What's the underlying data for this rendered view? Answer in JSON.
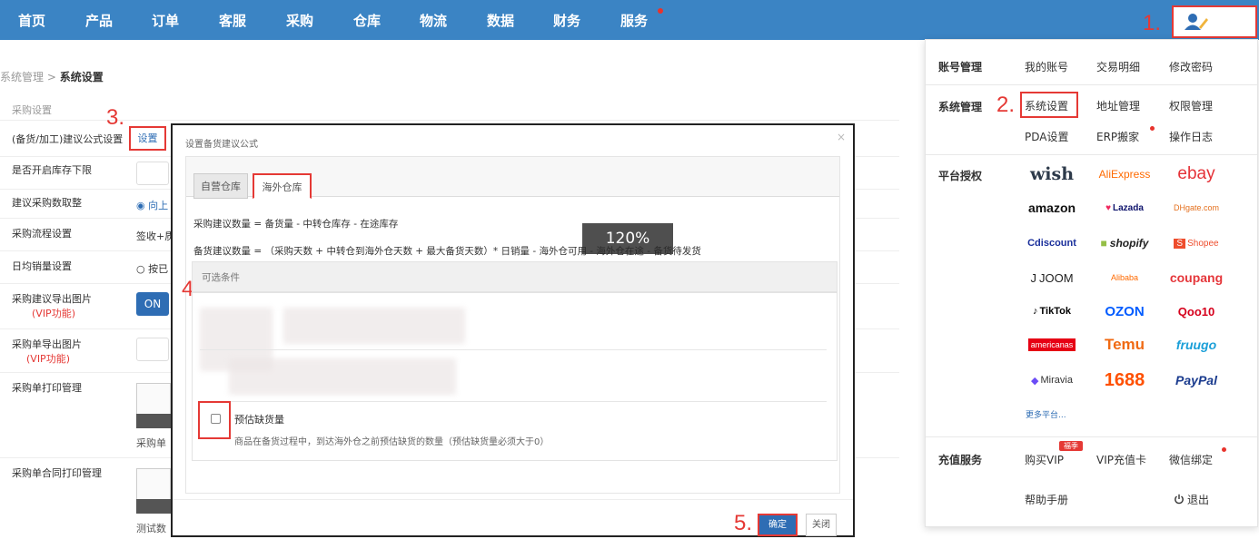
{
  "nav": {
    "items": [
      "首页",
      "产品",
      "订单",
      "客服",
      "采购",
      "仓库",
      "物流",
      "数据",
      "财务",
      "服务"
    ]
  },
  "annotations": [
    "1.",
    "2.",
    "3.",
    "4.",
    "5."
  ],
  "breadcrumb": {
    "parent": "系统管理",
    "sep": ">",
    "current": "系统设置"
  },
  "settings": {
    "section_title": "采购设置",
    "rows": [
      {
        "label": "(备货/加工)建议公式设置",
        "link": "设置"
      },
      {
        "label": "是否开启库存下限"
      },
      {
        "label": "建议采购数取整",
        "value": "◉ 向上"
      },
      {
        "label": "采购流程设置",
        "value": "签收+质"
      },
      {
        "label": "日均销量设置",
        "value": "○ 按已"
      },
      {
        "label": "采购建议导出图片",
        "vip": "(VIP功能)",
        "toggle": "ON"
      },
      {
        "label": "采购单导出图片",
        "vip": "(VIP功能)"
      },
      {
        "label": "采购单打印管理",
        "caption": "采购单"
      },
      {
        "label": "采购单合同打印管理",
        "caption": "测试数"
      }
    ]
  },
  "modal": {
    "title": "设置备货建议公式",
    "close": "×",
    "tabs": [
      "自营仓库",
      "海外仓库"
    ],
    "formula1": "采购建议数量 = 备货量 - 中转仓库存 - 在途库存",
    "formula2": "备货建议数量 = （采购天数 + 中转仓到海外仓天数 + 最大备货天数）* 日销量 - 海外仓可用 - 海外仓在途 - 备货待发货",
    "zoom": "120%",
    "conditions_header": "可选条件",
    "checkbox_label": "预估缺货量",
    "checkbox_desc": "商品在备货过程中，到达海外仓之前预估缺货的数量（预估缺货量必须大于0）",
    "ok": "确定",
    "cancel": "关闭"
  },
  "dropdown": {
    "account": {
      "title": "账号管理",
      "items": [
        "我的账号",
        "交易明细",
        "修改密码"
      ]
    },
    "system": {
      "title": "系统管理",
      "items": [
        "系统设置",
        "地址管理",
        "权限管理",
        "PDA设置",
        "ERP搬家",
        "操作日志"
      ]
    },
    "platform": {
      "title": "平台授权",
      "logos": [
        "wish",
        "AliExpress",
        "ebay",
        "amazon",
        "Lazada",
        "DHgate.com",
        "Cdiscount",
        "shopify",
        "Shopee",
        "JOOM",
        "Alibaba",
        "coupang",
        "TikTok",
        "OZON",
        "Qoo10",
        "americanas",
        "Temu",
        "fruugo",
        "Miravia",
        "1688",
        "PayPal"
      ],
      "more": "更多平台..."
    },
    "recharge": {
      "title": "充值服务",
      "items": [
        "购买VIP",
        "VIP充值卡",
        "微信绑定"
      ],
      "badge": "福季"
    },
    "help": "帮助手册",
    "logout": "退出"
  }
}
